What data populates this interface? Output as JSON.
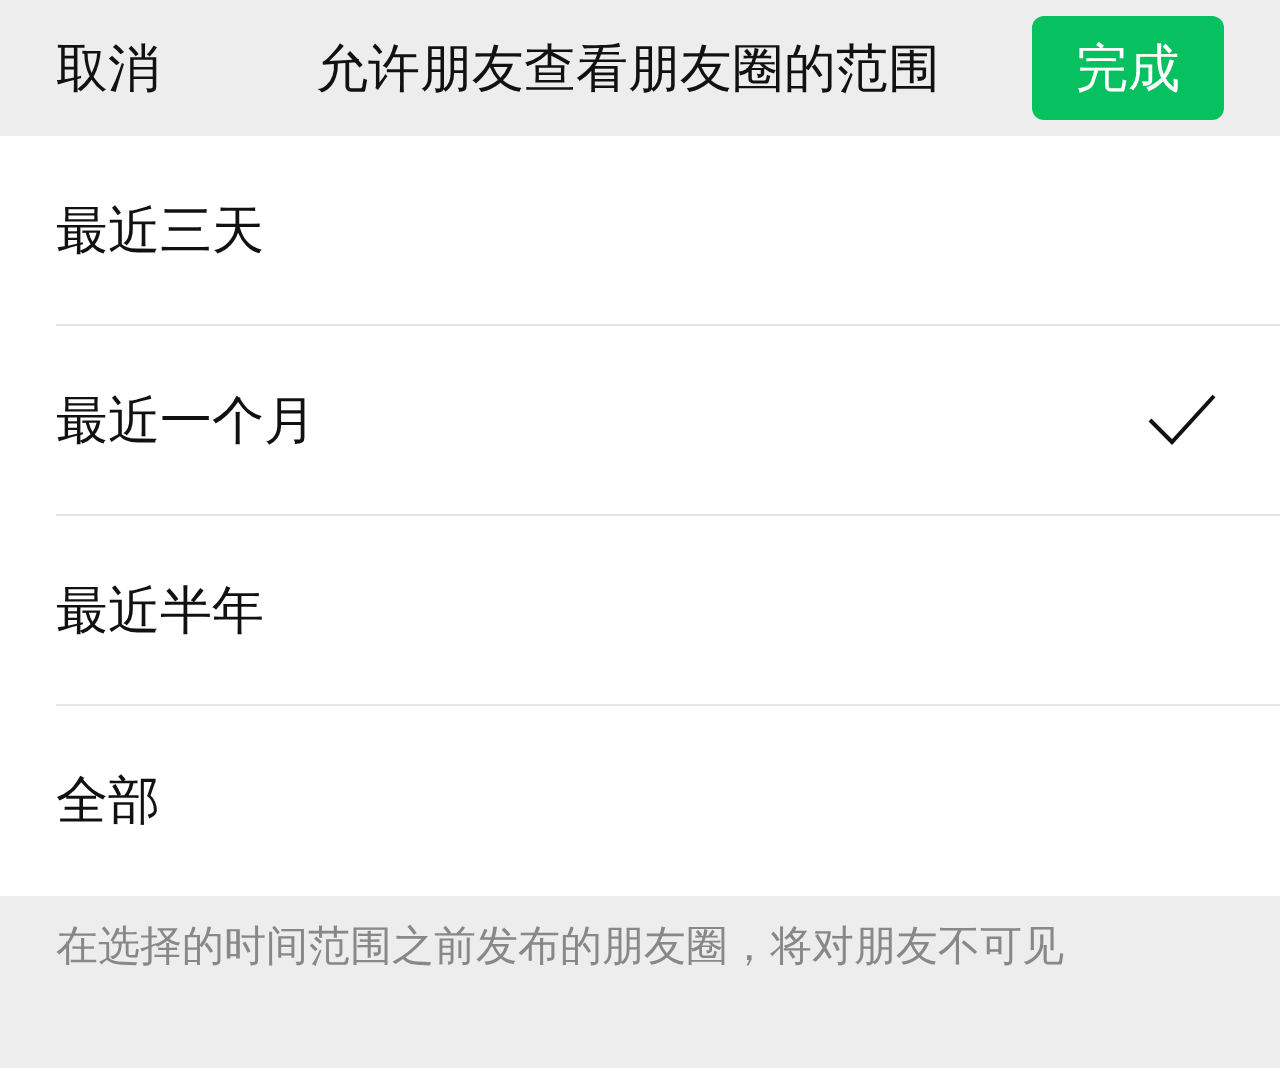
{
  "header": {
    "cancel": "取消",
    "title": "允许朋友查看朋友圈的范围",
    "done": "完成"
  },
  "options": [
    {
      "label": "最近三天",
      "selected": false
    },
    {
      "label": "最近一个月",
      "selected": true
    },
    {
      "label": "最近半年",
      "selected": false
    },
    {
      "label": "全部",
      "selected": false
    }
  ],
  "footer_note": "在选择的时间范围之前发布的朋友圈，将对朋友不可见"
}
